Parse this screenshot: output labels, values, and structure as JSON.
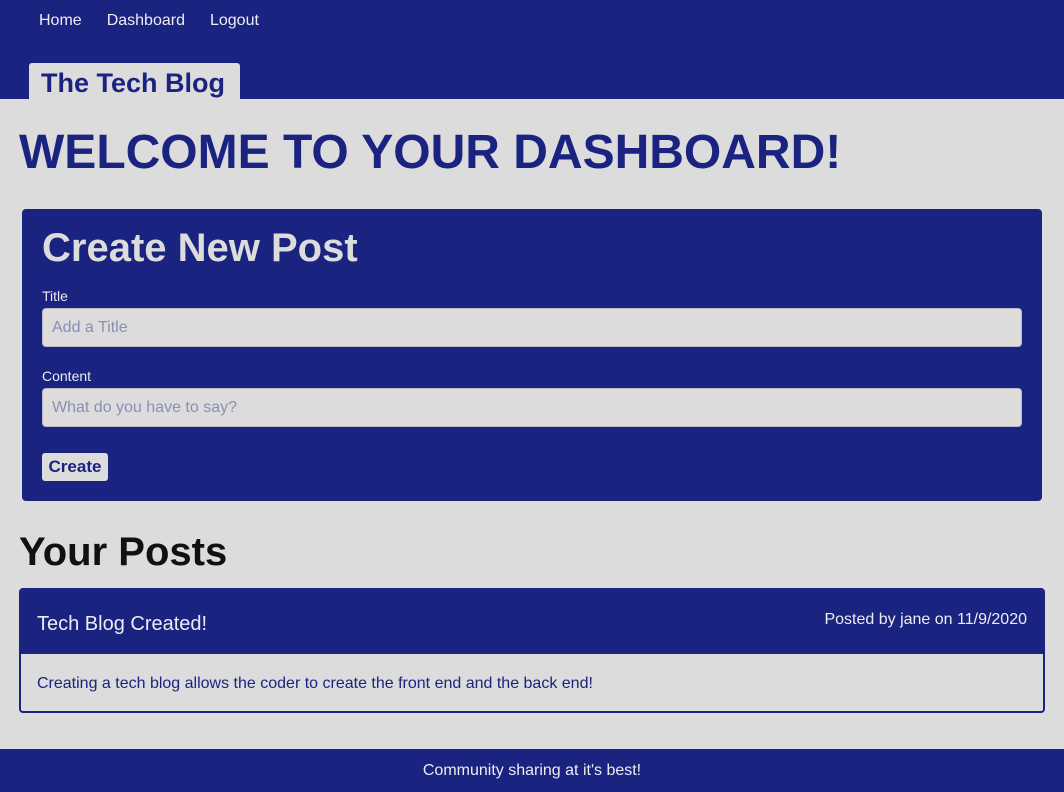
{
  "nav": {
    "items": [
      "Home",
      "Dashboard",
      "Logout"
    ]
  },
  "brand": {
    "title": "The Tech Blog"
  },
  "main": {
    "welcome": "WELCOME TO YOUR DASHBOARD!"
  },
  "create_post": {
    "heading": "Create New Post",
    "title_label": "Title",
    "title_placeholder": "Add a Title",
    "title_value": "",
    "content_label": "Content",
    "content_placeholder": "What do you have to say?",
    "content_value": "",
    "button_label": "Create"
  },
  "posts": {
    "heading": "Your Posts",
    "items": [
      {
        "title": "Tech Blog Created!",
        "meta": "Posted by jane on 11/9/2020",
        "body": "Creating a tech blog allows the coder to create the front end and the back end!"
      }
    ]
  },
  "footer": {
    "text": "Community sharing at it's best!"
  },
  "colors": {
    "primary": "#1b2380",
    "background": "#dcdcdc",
    "light_text": "#ececf2"
  }
}
